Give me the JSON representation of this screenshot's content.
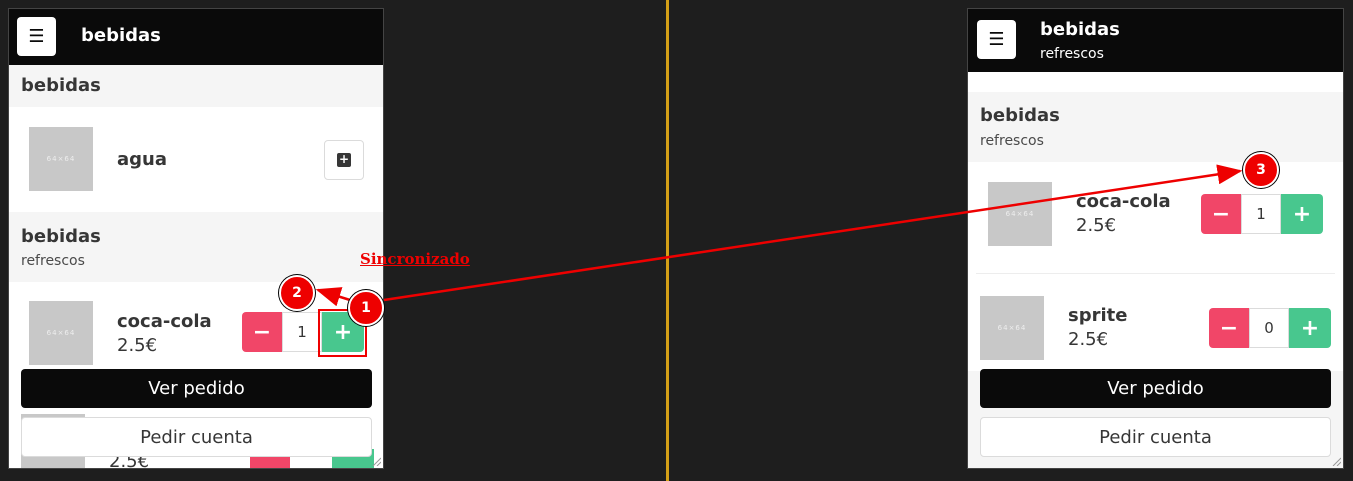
{
  "divider_color": "#d4a017",
  "left": {
    "appbar": {
      "title": "bebidas",
      "menu_icon": "hamburger-icon"
    },
    "sections": [
      {
        "title": "bebidas"
      },
      {
        "title": "bebidas",
        "subtitle": "refrescos"
      }
    ],
    "items": [
      {
        "name": "agua",
        "thumb": "64×64"
      },
      {
        "name": "coca-cola",
        "price": "2.5€",
        "qty": "1",
        "thumb": "64×64"
      },
      {
        "price": "2.5€"
      }
    ],
    "buttons": {
      "view_order": "Ver pedido",
      "request_bill": "Pedir cuenta"
    }
  },
  "right": {
    "appbar": {
      "title": "bebidas",
      "subtitle": "refrescos",
      "menu_icon": "hamburger-icon"
    },
    "section": {
      "title": "bebidas",
      "subtitle": "refrescos"
    },
    "items": [
      {
        "name": "coca-cola",
        "price": "2.5€",
        "qty": "1",
        "thumb": "64×64"
      },
      {
        "name": "sprite",
        "price": "2.5€",
        "qty": "0",
        "thumb": "64×64"
      }
    ],
    "buttons": {
      "view_order": "Ver pedido",
      "request_bill": "Pedir cuenta"
    }
  },
  "annotations": {
    "label": "Sincronizado",
    "badges": [
      "1",
      "2",
      "3"
    ],
    "color": "#e00000"
  },
  "colors": {
    "danger": "#f14668",
    "success": "#48c78e",
    "dark": "#0a0a0a"
  }
}
